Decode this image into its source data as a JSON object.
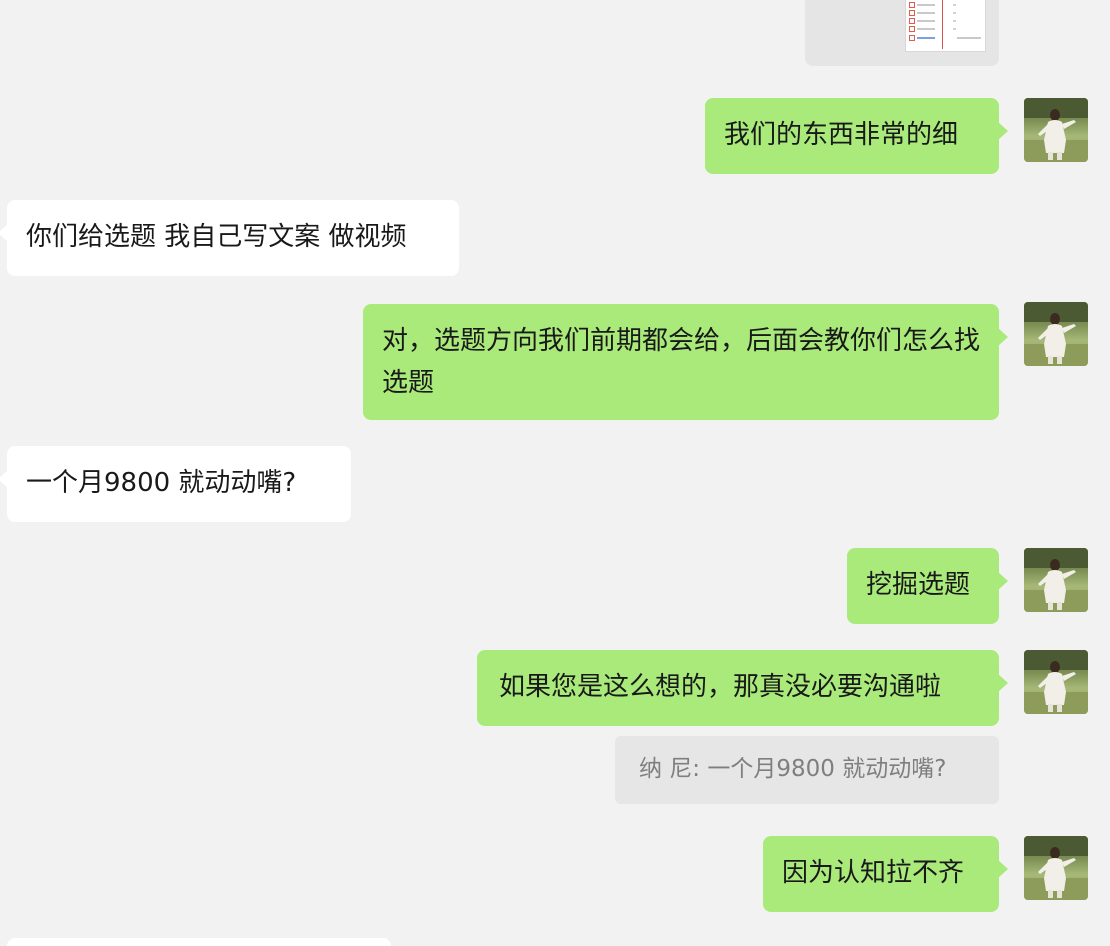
{
  "colors": {
    "chat_background": "#f2f2f2",
    "sent_bubble": "#a9ea7a",
    "received_bubble": "#ffffff",
    "quote_background": "#e6e6e6",
    "quote_text": "#7f7f7f"
  },
  "messages": [
    {
      "side": "sent",
      "type": "image",
      "avatar": "self-avatar"
    },
    {
      "side": "sent",
      "text": "我们的东西非常的细"
    },
    {
      "side": "received",
      "text": "你们给选题 我自己写文案 做视频"
    },
    {
      "side": "sent",
      "text": "对，选题方向我们前期都会给，后面会教你们怎么找选题"
    },
    {
      "side": "received",
      "text": "一个月9800  就动动嘴?"
    },
    {
      "side": "sent",
      "text": "挖掘选题"
    },
    {
      "side": "sent",
      "text": "如果您是这么想的，那真没必要沟通啦",
      "quote": "纳 尼: 一个月9800  就动动嘴?"
    },
    {
      "side": "sent",
      "text": "因为认知拉不齐"
    }
  ]
}
